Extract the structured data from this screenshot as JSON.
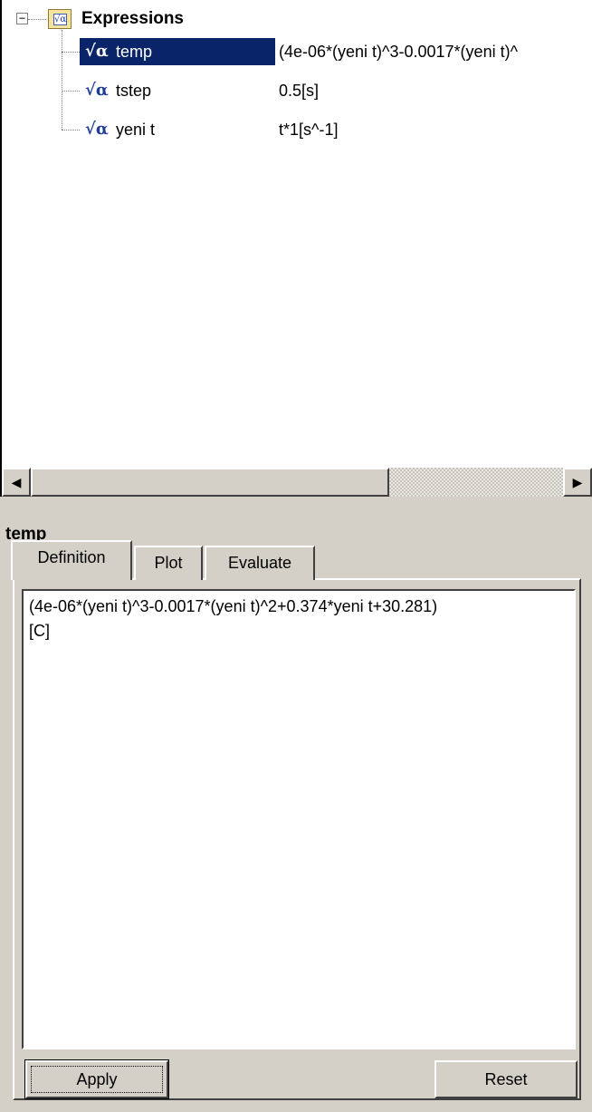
{
  "tree": {
    "root": {
      "label": "Expressions",
      "expander": "−",
      "icon": "expressions-folder-icon",
      "icon_glyph": "√α"
    },
    "items": [
      {
        "name": "temp",
        "value": "(4e-06*(yeni t)^3-0.0017*(yeni t)^",
        "icon": "sqrt-alpha-icon",
        "icon_glyph": "√α",
        "selected": true
      },
      {
        "name": "tstep",
        "value": "0.5[s]",
        "icon": "sqrt-alpha-icon",
        "icon_glyph": "√α",
        "selected": false
      },
      {
        "name": "yeni t",
        "value": "t*1[s^-1]",
        "icon": "sqrt-alpha-icon",
        "icon_glyph": "√α",
        "selected": false
      }
    ]
  },
  "scrollbar": {
    "left_arrow": "◀",
    "right_arrow": "▶"
  },
  "detail": {
    "title": "temp",
    "tabs": [
      {
        "label": "Definition",
        "active": true
      },
      {
        "label": "Plot",
        "active": false
      },
      {
        "label": "Evaluate",
        "active": false
      }
    ],
    "definition": "(4e-06*(yeni t)^3-0.0017*(yeni t)^2+0.374*yeni t+30.281)\n[C]",
    "apply_label": "Apply",
    "reset_label": "Reset"
  },
  "colors": {
    "selection": "#0a246a",
    "panel": "#d4d0c8",
    "icon_blue": "#1f3c9c"
  }
}
